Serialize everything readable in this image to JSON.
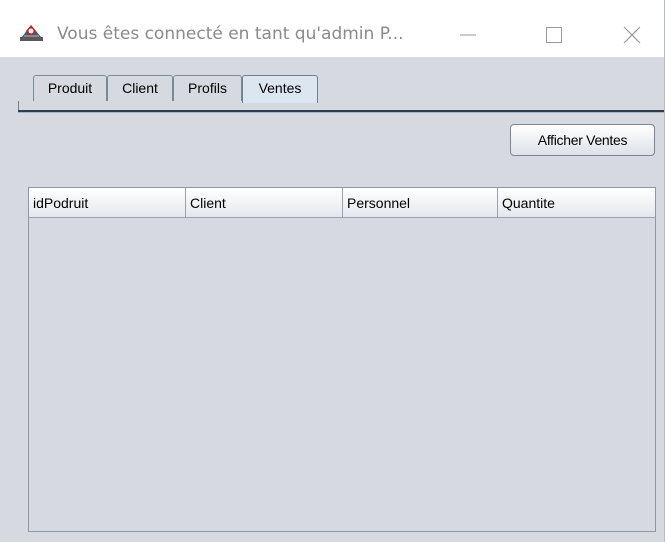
{
  "window": {
    "title": "Vous êtes connecté en tant qu'admin P..."
  },
  "tabs": [
    {
      "label": "Produit",
      "selected": false
    },
    {
      "label": "Client",
      "selected": false
    },
    {
      "label": "Profils",
      "selected": false
    },
    {
      "label": "Ventes",
      "selected": true
    }
  ],
  "toolbar": {
    "afficher_label": "Afficher Ventes"
  },
  "table": {
    "columns": [
      "idPodruit",
      "Client",
      "Personnel",
      "Quantite"
    ],
    "rows": []
  },
  "icons": {
    "app": "java-app-icon",
    "minimize": "minimize-icon",
    "maximize": "maximize-icon",
    "close": "close-icon"
  }
}
